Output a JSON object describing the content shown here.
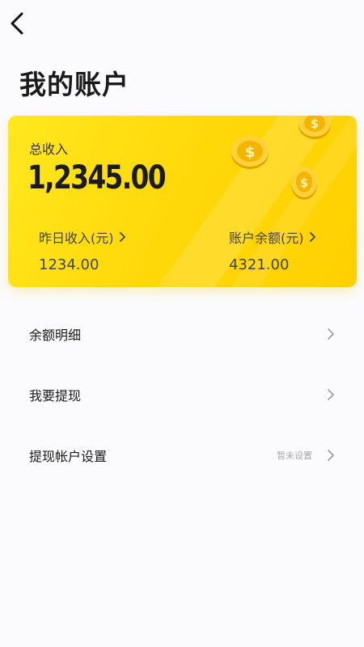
{
  "header": {
    "back_icon": "chevron-left-icon",
    "title": "我的账户"
  },
  "card": {
    "total_label": "总收入",
    "total_value": "1,2345.00",
    "yesterday": {
      "label": "昨日收入(元)",
      "value": "1234.00",
      "icon": "chevron-right-icon"
    },
    "balance": {
      "label": "账户余额(元)",
      "value": "4321.00",
      "icon": "chevron-right-icon"
    },
    "decoration": "gold-coins",
    "colors": {
      "card_start": "#ffe81f",
      "card_end": "#ffd000",
      "coin": "#f2b705"
    }
  },
  "menu": [
    {
      "label": "余额明细",
      "status": "",
      "icon": "chevron-right-icon"
    },
    {
      "label": "我要提现",
      "status": "",
      "icon": "chevron-right-icon"
    },
    {
      "label": "提现帐户设置",
      "status": "暂未设置",
      "icon": "chevron-right-icon"
    }
  ]
}
